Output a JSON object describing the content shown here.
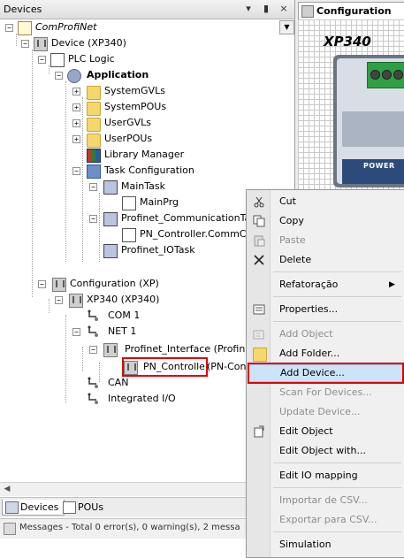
{
  "panel": {
    "title": "Devices",
    "pin": "↓  Ũ",
    "pin_icon": "pin-icon",
    "close": "×"
  },
  "tree": {
    "root": "ComProfiNet",
    "device": "Device (XP340)",
    "plc_logic": "PLC Logic",
    "application": "Application",
    "system_gvls": "SystemGVLs",
    "system_pous": "SystemPOUs",
    "user_gvls": "UserGVLs",
    "user_pous": "UserPOUs",
    "library_manager": "Library Manager",
    "task_configuration": "Task Configuration",
    "main_task": "MainTask",
    "main_prg": "MainPrg",
    "profinet_comm_task": "Profinet_CommunicationTask",
    "pn_controller_comm": "PN_Controller.CommCyc",
    "profinet_io_task": "Profinet_IOTask",
    "configuration": "Configuration (XP)",
    "xp340": "XP340 (XP340)",
    "com1": "COM 1",
    "net1": "NET 1",
    "profinet_interface": "Profinet_Interface (Profinet",
    "pn_controller": "PN_Controller",
    "pn_controller_suffix": "(PN-Contr",
    "can": "CAN",
    "integrated_io": "Integrated I/O"
  },
  "tabs": [
    {
      "label": "Devices"
    },
    {
      "label": "POUs"
    }
  ],
  "messages": {
    "text": "Messages - Total 0 error(s), 0 warning(s), 2 messa"
  },
  "editor": {
    "tab_label": "Configuration",
    "device_title": "XP340",
    "power_label": "POWER"
  },
  "context_menu": {
    "items": [
      {
        "label": "Cut",
        "icon": "scissors-icon",
        "enabled": true
      },
      {
        "label": "Copy",
        "icon": "copy-icon",
        "enabled": true
      },
      {
        "label": "Paste",
        "icon": "paste-icon",
        "enabled": false
      },
      {
        "label": "Delete",
        "icon": "delete-icon",
        "enabled": true
      },
      {
        "label": "Refatoração",
        "icon": "",
        "enabled": true,
        "submenu": true
      },
      {
        "label": "Properties...",
        "icon": "properties-icon",
        "enabled": true
      },
      {
        "label": "Add Object",
        "icon": "add-object-icon",
        "enabled": false
      },
      {
        "label": "Add Folder...",
        "icon": "folder-icon",
        "enabled": true
      },
      {
        "label": "Add Device...",
        "icon": "",
        "enabled": true,
        "highlighted": true
      },
      {
        "label": "Scan For Devices...",
        "icon": "",
        "enabled": false
      },
      {
        "label": "Update Device...",
        "icon": "",
        "enabled": false
      },
      {
        "label": "Edit Object",
        "icon": "edit-object-icon",
        "enabled": true
      },
      {
        "label": "Edit Object with...",
        "icon": "",
        "enabled": true
      },
      {
        "label": "Edit IO mapping",
        "icon": "",
        "enabled": true
      },
      {
        "label": "Importar de CSV...",
        "icon": "",
        "enabled": false
      },
      {
        "label": "Exportar para CSV...",
        "icon": "",
        "enabled": false
      },
      {
        "label": "Simulation",
        "icon": "",
        "enabled": true
      }
    ]
  },
  "colors": {
    "highlight_red": "#e00000",
    "menu_hover": "#cce4f7"
  }
}
